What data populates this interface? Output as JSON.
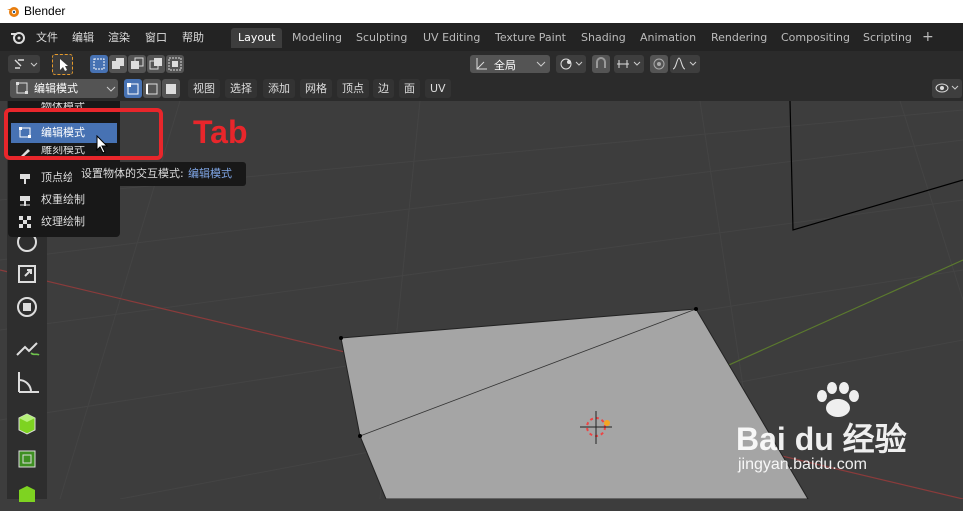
{
  "window": {
    "title": "Blender"
  },
  "menu": [
    "文件",
    "编辑",
    "渲染",
    "窗口",
    "帮助"
  ],
  "workspaces": [
    {
      "label": "Layout",
      "active": true
    },
    {
      "label": "Modeling"
    },
    {
      "label": "Sculpting"
    },
    {
      "label": "UV Editing"
    },
    {
      "label": "Texture Paint"
    },
    {
      "label": "Shading"
    },
    {
      "label": "Animation"
    },
    {
      "label": "Rendering"
    },
    {
      "label": "Compositing"
    },
    {
      "label": "Scripting"
    }
  ],
  "toolbar": {
    "transform_orientation": "全局"
  },
  "header": {
    "mode_selector": "编辑模式",
    "menus": [
      "视图",
      "选择",
      "添加",
      "网格",
      "顶点",
      "边",
      "面",
      "UV"
    ]
  },
  "mode_menu": {
    "items": [
      {
        "label": "物体模式",
        "icon": "object-mode-icon"
      },
      {
        "label": "编辑模式",
        "icon": "edit-mode-icon",
        "selected": true
      },
      {
        "label": "雕刻模式",
        "icon": "sculpt-mode-icon"
      },
      {
        "label": "顶点绘制",
        "icon": "vertex-paint-icon"
      },
      {
        "label": "权重绘制",
        "icon": "weight-paint-icon"
      },
      {
        "label": "纹理绘制",
        "icon": "texture-paint-icon"
      }
    ]
  },
  "tooltip": {
    "prefix": "设置物体的交互模式:",
    "value": "编辑模式"
  },
  "annotation": {
    "text": "Tab",
    "color": "#e8262b"
  },
  "watermark": {
    "brand": "Bai du 经验",
    "url": "jingyan.baidu.com"
  },
  "colors": {
    "selection": "#4772b3",
    "background": "#3d3d3d",
    "header": "#2b2b2b"
  }
}
